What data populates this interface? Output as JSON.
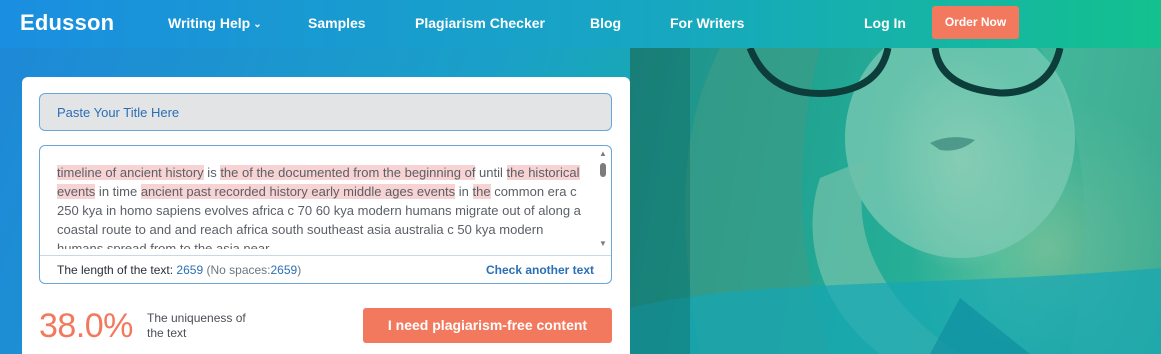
{
  "nav": {
    "logo": "Edusson",
    "items": [
      {
        "label": "Writing Help"
      },
      {
        "label": "Samples"
      },
      {
        "label": "Plagiarism Checker"
      },
      {
        "label": "Blog"
      },
      {
        "label": "For Writers"
      }
    ],
    "login_label": "Log In",
    "order_label": "Order Now"
  },
  "checker": {
    "title_placeholder": "Paste Your Title Here",
    "text_segments": [
      {
        "text": "timeline of ancient history",
        "highlight": true
      },
      {
        "text": " is ",
        "highlight": false
      },
      {
        "text": "the of the documented from the beginning of",
        "highlight": true
      },
      {
        "text": " until ",
        "highlight": false
      },
      {
        "text": "the historical events",
        "highlight": true
      },
      {
        "text": " in time ",
        "highlight": false
      },
      {
        "text": "ancient past recorded history early middle ages events",
        "highlight": true
      },
      {
        "text": " in ",
        "highlight": false
      },
      {
        "text": "the",
        "highlight": true
      },
      {
        "text": " common era c 250 kya in homo sapiens evolves africa c 70 60 kya modern humans migrate out of along a coastal route to and and reach africa south southeast asia australia c 50 kya modern humans spread from to the asia near",
        "highlight": false
      }
    ],
    "length_label": "The length of the text:",
    "length_value": "2659",
    "no_spaces_label": "(No spaces:",
    "no_spaces_value": "2659",
    "no_spaces_close": ")",
    "check_another_label": "Check another text",
    "uniqueness_percent": "38.0%",
    "uniqueness_label": "The uniqueness of the text",
    "cta_label": "I need plagiarism-free content"
  },
  "colors": {
    "accent": "#f2795d",
    "link_blue": "#2a6fb5",
    "highlight": "#f8d3d3"
  }
}
